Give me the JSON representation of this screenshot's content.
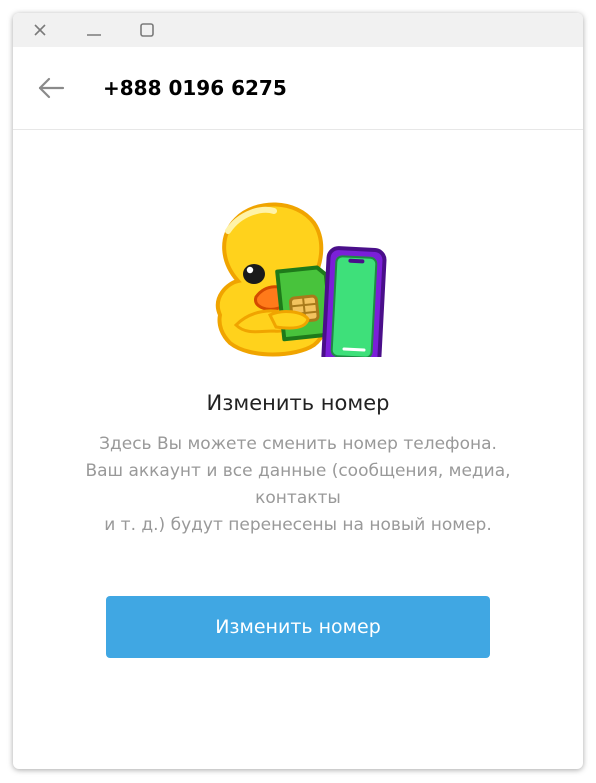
{
  "window": {
    "controls": {
      "close_icon": "close-icon",
      "minimize_icon": "minimize-icon",
      "maximize_icon": "maximize-icon"
    }
  },
  "header": {
    "back_icon": "arrow-left-icon",
    "title": "+888 0196 6275"
  },
  "content": {
    "sticker": "duck-holding-sim-card-and-phone",
    "heading": "Изменить номер",
    "description_lines": [
      "Здесь Вы можете сменить номер телефона.",
      "Ваш аккаунт и все данные (сообщения, медиа,",
      "контакты",
      "и т. д.) будут перенесены на новый номер."
    ],
    "button_label": "Изменить номер"
  },
  "colors": {
    "accent": "#40a7e3",
    "heading": "#222222",
    "description": "#999999",
    "titlebar": "#f1f1f1"
  }
}
